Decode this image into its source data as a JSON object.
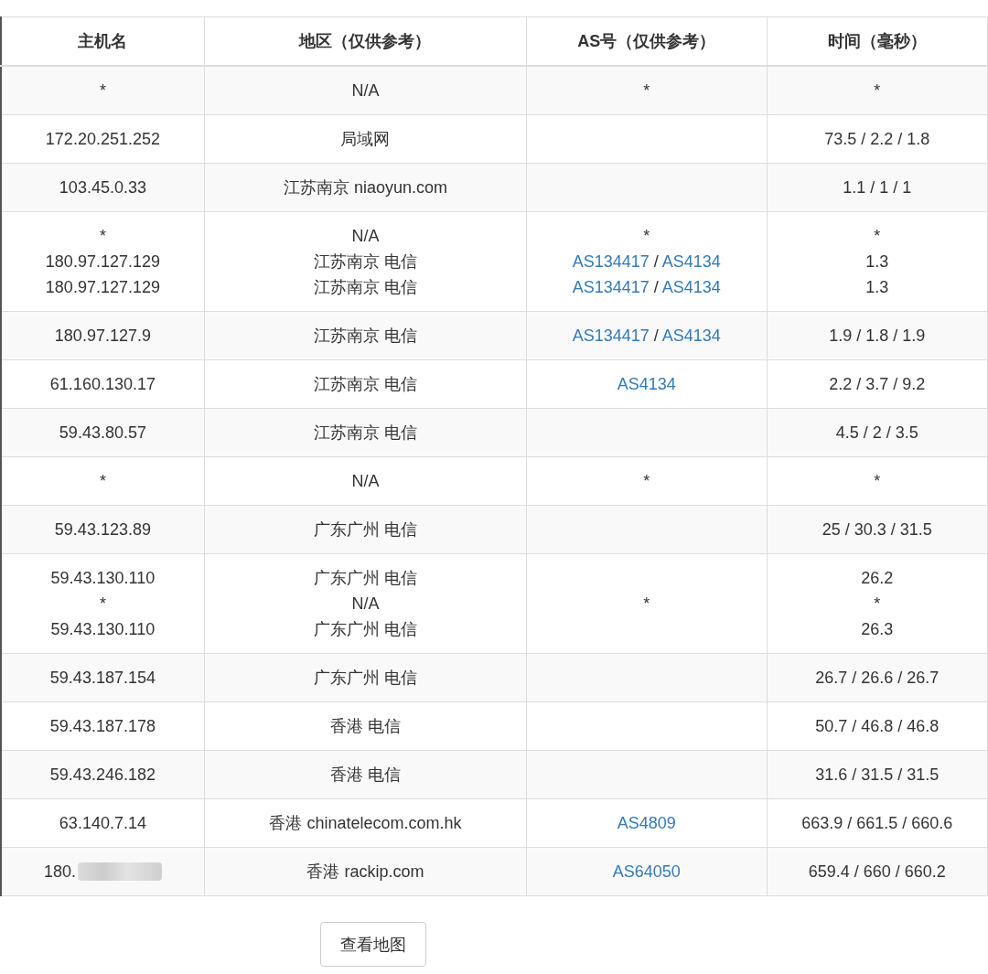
{
  "table": {
    "columns": [
      "主机名",
      "地区（仅供参考）",
      "AS号（仅供参考）",
      "时间（毫秒）"
    ],
    "rows": [
      {
        "host": [
          "*"
        ],
        "region": [
          "N/A"
        ],
        "as": [
          [
            {
              "text": "*",
              "link": false
            }
          ]
        ],
        "time": [
          "*"
        ]
      },
      {
        "host": [
          "172.20.251.252"
        ],
        "region": [
          "局域网"
        ],
        "as": [],
        "time": [
          "73.5 / 2.2 / 1.8"
        ]
      },
      {
        "host": [
          "103.45.0.33"
        ],
        "region": [
          "江苏南京 niaoyun.com"
        ],
        "as": [],
        "time": [
          "1.1 / 1 / 1"
        ]
      },
      {
        "host": [
          "*",
          "180.97.127.129",
          "180.97.127.129"
        ],
        "region": [
          "N/A",
          "江苏南京 电信",
          "江苏南京 电信"
        ],
        "as": [
          [
            {
              "text": "*",
              "link": false
            }
          ],
          [
            {
              "text": "AS134417",
              "link": true
            },
            {
              "text": " / ",
              "link": false
            },
            {
              "text": "AS4134",
              "link": true
            }
          ],
          [
            {
              "text": "AS134417",
              "link": true
            },
            {
              "text": " / ",
              "link": false
            },
            {
              "text": "AS4134",
              "link": true
            }
          ]
        ],
        "time": [
          "*",
          "1.3",
          "1.3"
        ]
      },
      {
        "host": [
          "180.97.127.9"
        ],
        "region": [
          "江苏南京 电信"
        ],
        "as": [
          [
            {
              "text": "AS134417",
              "link": true
            },
            {
              "text": " / ",
              "link": false
            },
            {
              "text": "AS4134",
              "link": true
            }
          ]
        ],
        "time": [
          "1.9 / 1.8 / 1.9"
        ]
      },
      {
        "host": [
          "61.160.130.17"
        ],
        "region": [
          "江苏南京 电信"
        ],
        "as": [
          [
            {
              "text": "AS4134",
              "link": true
            }
          ]
        ],
        "time": [
          "2.2 / 3.7 / 9.2"
        ]
      },
      {
        "host": [
          "59.43.80.57"
        ],
        "region": [
          "江苏南京 电信"
        ],
        "as": [],
        "time": [
          "4.5 / 2 / 3.5"
        ]
      },
      {
        "host": [
          "*"
        ],
        "region": [
          "N/A"
        ],
        "as": [
          [
            {
              "text": "*",
              "link": false
            }
          ]
        ],
        "time": [
          "*"
        ]
      },
      {
        "host": [
          "59.43.123.89"
        ],
        "region": [
          "广东广州 电信"
        ],
        "as": [],
        "time": [
          "25 / 30.3 / 31.5"
        ]
      },
      {
        "host": [
          "59.43.130.110",
          "*",
          "59.43.130.110"
        ],
        "region": [
          "广东广州 电信",
          "N/A",
          "广东广州 电信"
        ],
        "as": [
          [
            {
              "text": "*",
              "link": false
            }
          ]
        ],
        "time": [
          "26.2",
          "*",
          "26.3"
        ]
      },
      {
        "host": [
          "59.43.187.154"
        ],
        "region": [
          "广东广州 电信"
        ],
        "as": [],
        "time": [
          "26.7 / 26.6 / 26.7"
        ]
      },
      {
        "host": [
          "59.43.187.178"
        ],
        "region": [
          "香港 电信"
        ],
        "as": [],
        "time": [
          "50.7 / 46.8 / 46.8"
        ]
      },
      {
        "host": [
          "59.43.246.182"
        ],
        "region": [
          "香港 电信"
        ],
        "as": [],
        "time": [
          "31.6 / 31.5 / 31.5"
        ]
      },
      {
        "host": [
          "63.140.7.14"
        ],
        "region": [
          "香港 chinatelecom.com.hk"
        ],
        "as": [
          [
            {
              "text": "AS4809",
              "link": true
            }
          ]
        ],
        "time": [
          "663.9 / 661.5 / 660.6"
        ]
      },
      {
        "host": [
          "180."
        ],
        "host_redacted": true,
        "region": [
          "香港 rackip.com"
        ],
        "as": [
          [
            {
              "text": "AS64050",
              "link": true
            }
          ]
        ],
        "time": [
          "659.4 / 660 / 660.2"
        ]
      }
    ]
  },
  "map_button": "查看地图"
}
